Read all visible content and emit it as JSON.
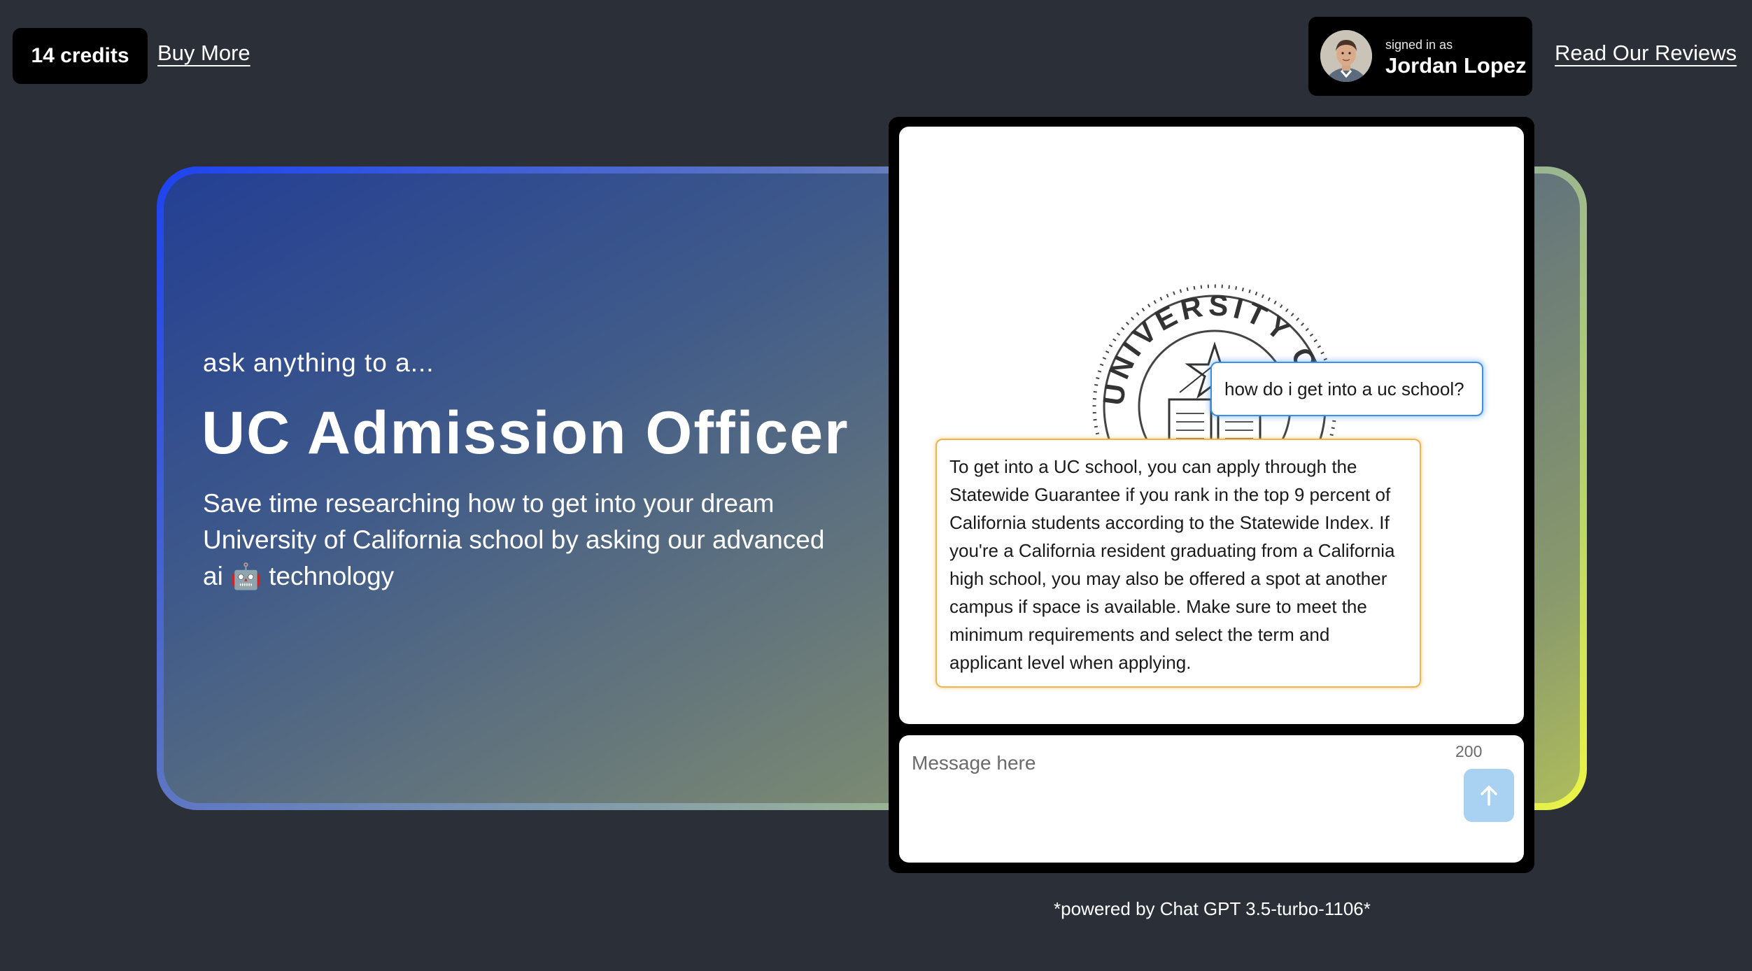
{
  "topbar": {
    "credits_label": "14 credits",
    "buy_more": "Buy More",
    "signed_in_as": "signed in as",
    "user_name": "Jordan Lopez",
    "read_reviews": "Read Our Reviews"
  },
  "hero": {
    "eyebrow": "ask anything to a...",
    "title": "UC Admission Officer",
    "description_before": "Save time researching how to get into your dream University of California school by asking our advanced ai",
    "robot_emoji": "🤖",
    "description_after": "technology"
  },
  "chat": {
    "seal_text": "UNIVERSITY OF CA",
    "user_message": "how do i get into a uc school?",
    "ai_message": "To get into a UC school, you can apply through the Statewide Guarantee if you rank in the top 9 percent of California students according to the Statewide Index. If you're a California resident graduating from a California high school, you may also be offered a spot at another campus if space is available. Make sure to meet the minimum requirements and select the term and applicant level when applying.",
    "input_placeholder": "Message here",
    "char_count": "200",
    "send_icon": "arrow-up-icon"
  },
  "footer": {
    "powered_by": "*powered by Chat GPT 3.5-turbo-1106*"
  },
  "colors": {
    "background": "#2b2f38",
    "user_bubble_border": "#3d8fe6",
    "ai_bubble_border": "#f2b34c",
    "send_button": "#a9d1f2"
  }
}
